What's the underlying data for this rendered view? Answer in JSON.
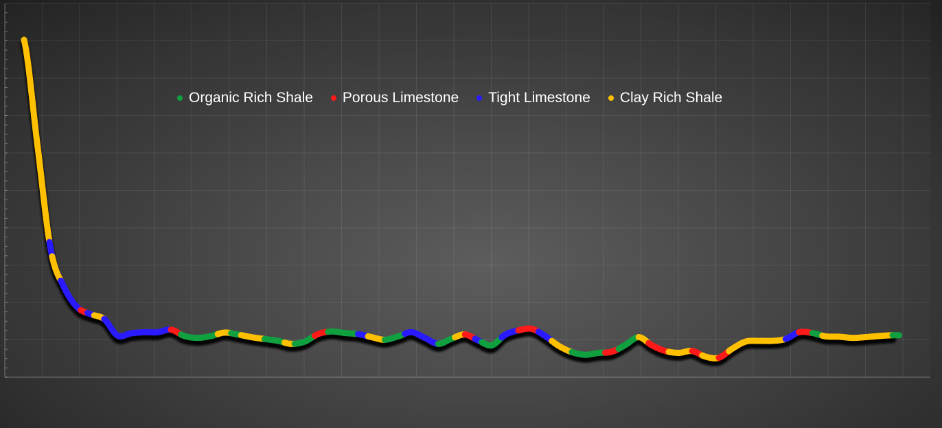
{
  "chart_data": {
    "type": "line",
    "title": "",
    "xlabel": "",
    "ylabel": "",
    "grid": true,
    "legend_placement": "top-left",
    "xlim": [
      0,
      131
    ],
    "ylim": [
      0,
      9
    ],
    "series": [
      {
        "name": "Organic Rich Shale",
        "color": "#10a040"
      },
      {
        "name": "Porous Limestone",
        "color": "#ff1a1a"
      },
      {
        "name": "Tight Limestone",
        "color": "#2a1aff"
      },
      {
        "name": "Clay Rich Shale",
        "color": "#ffc000"
      }
    ],
    "curve": [
      [
        0,
        9.0
      ],
      [
        2,
        6.2
      ],
      [
        4,
        3.4
      ],
      [
        6,
        2.4
      ],
      [
        8,
        1.86
      ],
      [
        10,
        1.68
      ],
      [
        12,
        1.55
      ],
      [
        14,
        1.11
      ],
      [
        16,
        1.17
      ],
      [
        18,
        1.2
      ],
      [
        20,
        1.2
      ],
      [
        22,
        1.27
      ],
      [
        24,
        1.1
      ],
      [
        26,
        1.05
      ],
      [
        28,
        1.1
      ],
      [
        30,
        1.19
      ],
      [
        32,
        1.14
      ],
      [
        34,
        1.07
      ],
      [
        36,
        1.02
      ],
      [
        38,
        0.97
      ],
      [
        40,
        0.89
      ],
      [
        42,
        0.95
      ],
      [
        44,
        1.15
      ],
      [
        46,
        1.22
      ],
      [
        48,
        1.18
      ],
      [
        50,
        1.15
      ],
      [
        52,
        1.07
      ],
      [
        54,
        1.0
      ],
      [
        56,
        1.09
      ],
      [
        58,
        1.2
      ],
      [
        60,
        1.05
      ],
      [
        62,
        0.89
      ],
      [
        64,
        1.03
      ],
      [
        66,
        1.14
      ],
      [
        68,
        0.98
      ],
      [
        70,
        0.85
      ],
      [
        72,
        1.13
      ],
      [
        74,
        1.25
      ],
      [
        76,
        1.29
      ],
      [
        78,
        1.1
      ],
      [
        80,
        0.84
      ],
      [
        82,
        0.67
      ],
      [
        84,
        0.6
      ],
      [
        86,
        0.65
      ],
      [
        88,
        0.68
      ],
      [
        90,
        0.86
      ],
      [
        92,
        1.07
      ],
      [
        94,
        0.85
      ],
      [
        96,
        0.7
      ],
      [
        98,
        0.65
      ],
      [
        100,
        0.7
      ],
      [
        102,
        0.55
      ],
      [
        104,
        0.52
      ],
      [
        106,
        0.76
      ],
      [
        108,
        0.95
      ],
      [
        110,
        0.97
      ],
      [
        112,
        0.97
      ],
      [
        114,
        1.02
      ],
      [
        116,
        1.2
      ],
      [
        118,
        1.18
      ],
      [
        120,
        1.09
      ],
      [
        122,
        1.08
      ],
      [
        124,
        1.05
      ],
      [
        126,
        1.07
      ],
      [
        128,
        1.1
      ],
      [
        130,
        1.12
      ]
    ],
    "segments": [
      [
        0,
        3.8,
        "Clay Rich Shale"
      ],
      [
        3.8,
        4.2,
        "Tight Limestone"
      ],
      [
        4.2,
        5.5,
        "Clay Rich Shale"
      ],
      [
        5.5,
        8.5,
        "Tight Limestone"
      ],
      [
        8.5,
        9.5,
        "Porous Limestone"
      ],
      [
        9.5,
        10.5,
        "Tight Limestone"
      ],
      [
        10.5,
        12,
        "Clay Rich Shale"
      ],
      [
        12,
        22,
        "Tight Limestone"
      ],
      [
        22,
        23.5,
        "Porous Limestone"
      ],
      [
        23.5,
        29,
        "Organic Rich Shale"
      ],
      [
        29,
        31,
        "Clay Rich Shale"
      ],
      [
        31,
        32.5,
        "Organic Rich Shale"
      ],
      [
        32.5,
        36,
        "Clay Rich Shale"
      ],
      [
        36,
        39,
        "Organic Rich Shale"
      ],
      [
        39,
        40.5,
        "Clay Rich Shale"
      ],
      [
        40.5,
        43.5,
        "Organic Rich Shale"
      ],
      [
        43.5,
        45.5,
        "Porous Limestone"
      ],
      [
        45.5,
        50,
        "Organic Rich Shale"
      ],
      [
        50,
        51.5,
        "Tight Limestone"
      ],
      [
        51.5,
        54,
        "Clay Rich Shale"
      ],
      [
        54,
        57,
        "Organic Rich Shale"
      ],
      [
        57,
        62,
        "Tight Limestone"
      ],
      [
        62,
        64.5,
        "Organic Rich Shale"
      ],
      [
        64.5,
        66,
        "Clay Rich Shale"
      ],
      [
        66,
        67.5,
        "Porous Limestone"
      ],
      [
        67.5,
        68.5,
        "Tight Limestone"
      ],
      [
        68.5,
        71.5,
        "Organic Rich Shale"
      ],
      [
        71.5,
        74,
        "Tight Limestone"
      ],
      [
        74,
        77,
        "Porous Limestone"
      ],
      [
        77,
        79,
        "Tight Limestone"
      ],
      [
        79,
        82,
        "Clay Rich Shale"
      ],
      [
        82,
        87,
        "Organic Rich Shale"
      ],
      [
        87,
        89,
        "Porous Limestone"
      ],
      [
        89,
        92,
        "Organic Rich Shale"
      ],
      [
        92,
        93.5,
        "Clay Rich Shale"
      ],
      [
        93.5,
        96.5,
        "Porous Limestone"
      ],
      [
        96.5,
        100,
        "Clay Rich Shale"
      ],
      [
        100,
        101.5,
        "Porous Limestone"
      ],
      [
        101.5,
        104,
        "Clay Rich Shale"
      ],
      [
        104,
        105.5,
        "Porous Limestone"
      ],
      [
        105.5,
        114,
        "Clay Rich Shale"
      ],
      [
        114,
        116,
        "Tight Limestone"
      ],
      [
        116,
        118,
        "Porous Limestone"
      ],
      [
        118,
        119.5,
        "Organic Rich Shale"
      ],
      [
        119.5,
        130,
        "Clay Rich Shale"
      ],
      [
        130,
        131,
        "Organic Rich Shale"
      ]
    ]
  }
}
